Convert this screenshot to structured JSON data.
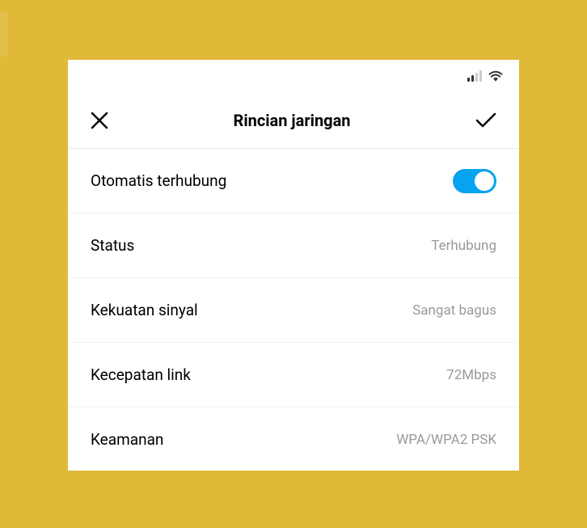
{
  "header": {
    "title": "Rincian jaringan"
  },
  "rows": {
    "auto_connect": {
      "label": "Otomatis terhubung"
    },
    "status": {
      "label": "Status",
      "value": "Terhubung"
    },
    "signal": {
      "label": "Kekuatan sinyal",
      "value": "Sangat bagus"
    },
    "speed": {
      "label": "Kecepatan link",
      "value": "72Mbps"
    },
    "security": {
      "label": "Keamanan",
      "value": "WPA/WPA2 PSK"
    }
  }
}
